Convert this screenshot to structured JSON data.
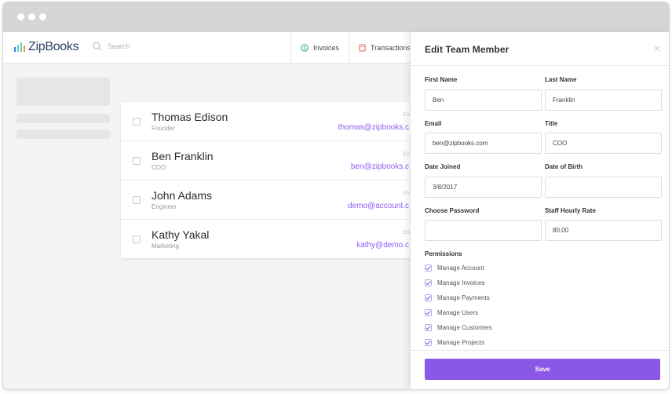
{
  "app": {
    "brand": "ZipBooks",
    "brand_colors": [
      "#2f80ed",
      "#56ccf2",
      "#6fcf97",
      "#f2994a",
      "#eb5757"
    ],
    "accent": "#8b57e6",
    "link_color": "#8b5cf6"
  },
  "nav": {
    "search_placeholder": "Search",
    "items": [
      {
        "label": "Invoices",
        "icon": "dollar-circle-icon",
        "icon_color": "#27ae60"
      },
      {
        "label": "Transactions",
        "icon": "receipt-icon",
        "icon_color": "#eb5757"
      }
    ]
  },
  "team": {
    "column_label": "EM",
    "members": [
      {
        "name": "Thomas Edison",
        "role": "Founder",
        "email": "thomas@zipbooks.c"
      },
      {
        "name": "Ben Franklin",
        "role": "COO",
        "email": "ben@zipbooks.c"
      },
      {
        "name": "John Adams",
        "role": "Engineer",
        "email": "demo@account.c"
      },
      {
        "name": "Kathy Yakal",
        "role": "Marketing",
        "email": "kathy@demo.c"
      }
    ]
  },
  "panel": {
    "title": "Edit Team Member",
    "fields": {
      "first_name": {
        "label": "First Name",
        "value": "Ben"
      },
      "last_name": {
        "label": "Last Name",
        "value": "Franklin"
      },
      "email": {
        "label": "Email",
        "value": "ben@zipbooks.com"
      },
      "title": {
        "label": "Title",
        "value": "COO"
      },
      "date_joined": {
        "label": "Date Joined",
        "value": "3/8/2017"
      },
      "date_of_birth": {
        "label": "Date of Birth",
        "value": ""
      },
      "password": {
        "label": "Choose Password",
        "value": ""
      },
      "hourly_rate": {
        "label": "Staff Hourly Rate",
        "value": "80.00"
      }
    },
    "permissions_label": "Permissions",
    "permissions": [
      {
        "label": "Manage Account",
        "checked": true
      },
      {
        "label": "Manage Invoices",
        "checked": true
      },
      {
        "label": "Manage Payments",
        "checked": true
      },
      {
        "label": "Manage Users",
        "checked": true
      },
      {
        "label": "Manage Customers",
        "checked": true
      },
      {
        "label": "Manage Projects",
        "checked": true
      }
    ],
    "save_label": "Save"
  }
}
